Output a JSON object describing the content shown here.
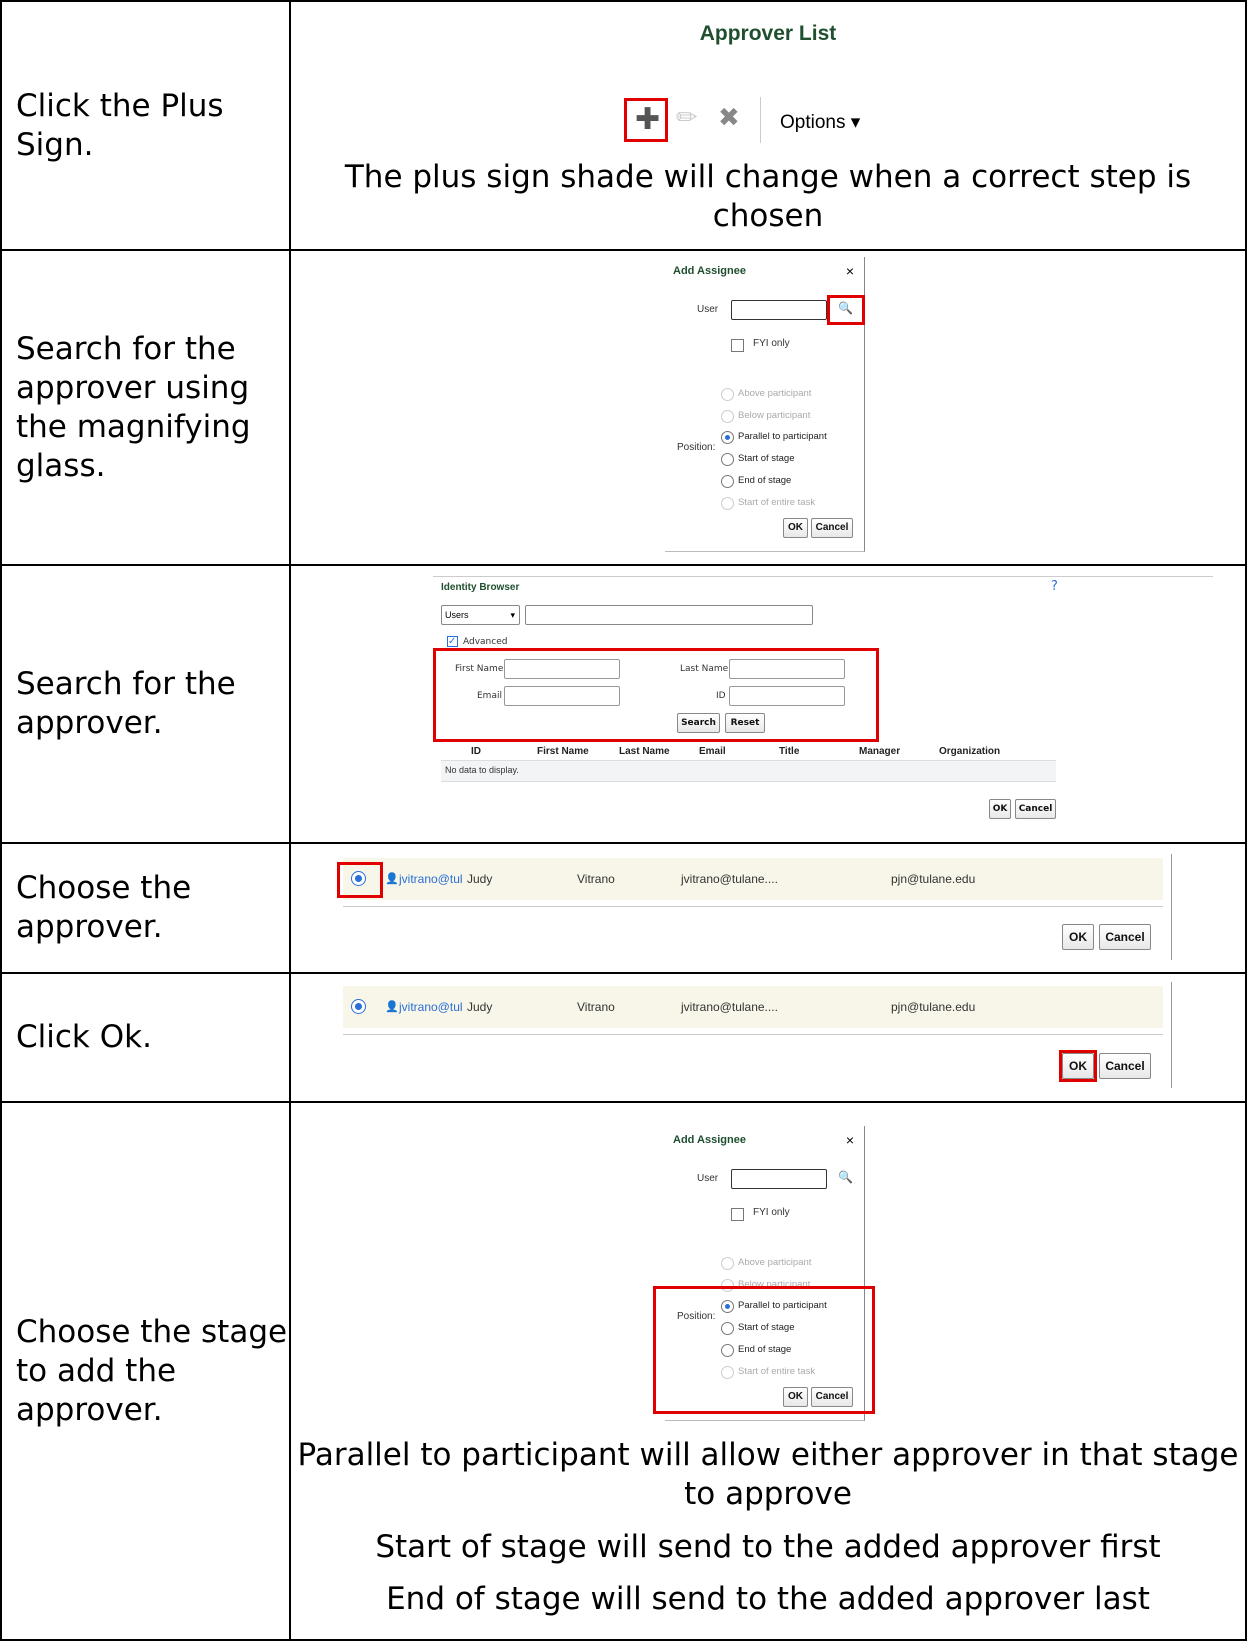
{
  "rows": [
    {
      "instruction": "Click the Plus Sign."
    },
    {
      "instruction": "Search for the approver using the magnifying glass."
    },
    {
      "instruction": "Search for the approver."
    },
    {
      "instruction": "Choose the approver."
    },
    {
      "instruction": "Click Ok."
    },
    {
      "instruction": "Choose the stage to add the approver."
    }
  ],
  "approver_list": {
    "title": "Approver List",
    "options_label": "Options ▾",
    "caption": "The plus sign shade will change when a correct step is chosen"
  },
  "add_assignee": {
    "title": "Add Assignee",
    "close": "×",
    "user_label": "User",
    "fyi_label": "FYI only",
    "position_label": "Position:",
    "options": [
      "Above participant",
      "Below participant",
      "Parallel to participant",
      "Start of stage",
      "End of stage",
      "Start of entire task"
    ],
    "ok": "OK",
    "cancel": "Cancel"
  },
  "identity_browser": {
    "title": "Identity Browser",
    "type_select": "Users",
    "advanced_label": "Advanced",
    "first_name_label": "First Name",
    "last_name_label": "Last Name",
    "email_label": "Email",
    "id_label": "ID",
    "search": "Search",
    "reset": "Reset",
    "columns": [
      "ID",
      "First Name",
      "Last Name",
      "Email",
      "Title",
      "Manager",
      "Organization"
    ],
    "empty_text": "No data to display.",
    "ok": "OK",
    "cancel": "Cancel"
  },
  "result_row": {
    "id": "jvitrano@tul",
    "first_name": "Judy",
    "last_name": "Vitrano",
    "email": "jvitrano@tulane....",
    "manager": "pjn@tulane.edu",
    "ok": "OK",
    "cancel": "Cancel"
  },
  "stage_notes": [
    "Parallel to participant will allow either approver in that stage to approve",
    "Start of stage will send to the added approver first",
    "End of stage will send to the added approver last"
  ]
}
